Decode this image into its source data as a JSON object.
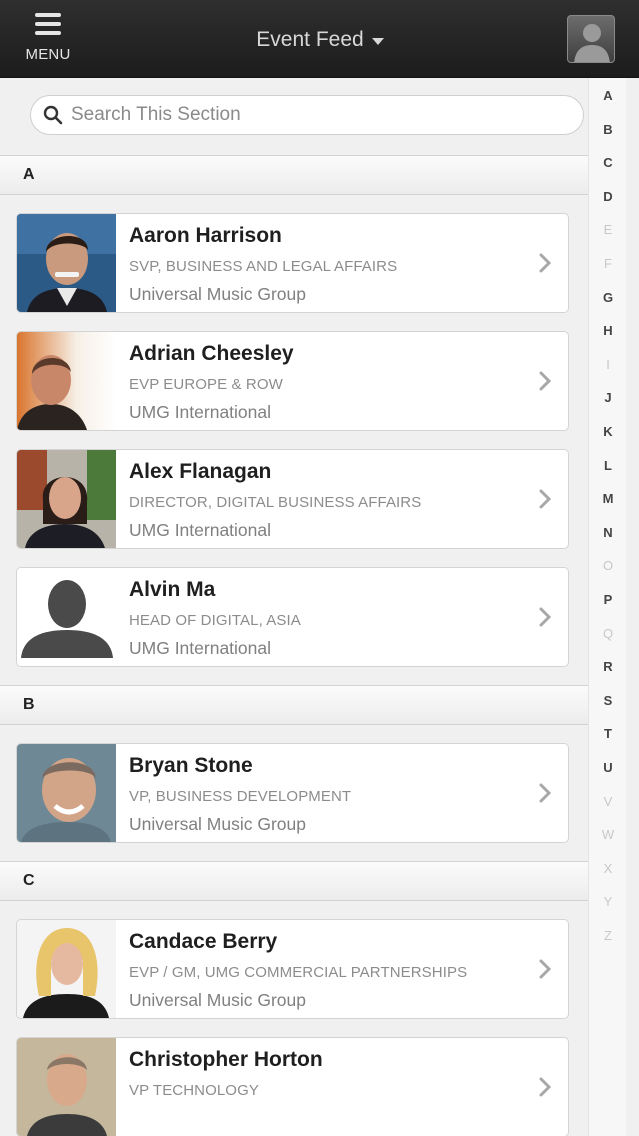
{
  "header": {
    "menu_label": "MENU",
    "title": "Event Feed"
  },
  "search": {
    "placeholder": "Search This Section"
  },
  "sections": [
    {
      "letter": "A",
      "people": [
        {
          "name": "Aaron Harrison",
          "role": "SVP, BUSINESS AND LEGAL AFFAIRS",
          "org": "Universal Music Group",
          "photo": "photo-aaron"
        },
        {
          "name": "Adrian Cheesley",
          "role": "EVP EUROPE & ROW",
          "org": "UMG International",
          "photo": "photo-adrian"
        },
        {
          "name": "Alex Flanagan",
          "role": "DIRECTOR, DIGITAL BUSINESS AFFAIRS",
          "org": "UMG International",
          "photo": "photo-alex"
        },
        {
          "name": "Alvin Ma",
          "role": "HEAD OF DIGITAL, ASIA",
          "org": "UMG International",
          "photo": "placeholder-person-icon"
        }
      ]
    },
    {
      "letter": "B",
      "people": [
        {
          "name": "Bryan Stone",
          "role": "VP, BUSINESS DEVELOPMENT",
          "org": "Universal Music Group",
          "photo": "photo-bryan"
        }
      ]
    },
    {
      "letter": "C",
      "people": [
        {
          "name": "Candace Berry",
          "role": "EVP / GM, UMG COMMERCIAL PARTNERSHIPS",
          "org": "Universal Music Group",
          "photo": "photo-candace"
        },
        {
          "name": "Christopher Horton",
          "role": "VP TECHNOLOGY",
          "org": "",
          "photo": "photo-christopher"
        }
      ]
    }
  ],
  "alphabet_index": [
    {
      "letter": "A",
      "active": true
    },
    {
      "letter": "B",
      "active": true
    },
    {
      "letter": "C",
      "active": true
    },
    {
      "letter": "D",
      "active": true
    },
    {
      "letter": "E",
      "active": false
    },
    {
      "letter": "F",
      "active": false
    },
    {
      "letter": "G",
      "active": true
    },
    {
      "letter": "H",
      "active": true
    },
    {
      "letter": "I",
      "active": false
    },
    {
      "letter": "J",
      "active": true
    },
    {
      "letter": "K",
      "active": true
    },
    {
      "letter": "L",
      "active": true
    },
    {
      "letter": "M",
      "active": true
    },
    {
      "letter": "N",
      "active": true
    },
    {
      "letter": "O",
      "active": false
    },
    {
      "letter": "P",
      "active": true
    },
    {
      "letter": "Q",
      "active": false
    },
    {
      "letter": "R",
      "active": true
    },
    {
      "letter": "S",
      "active": true
    },
    {
      "letter": "T",
      "active": true
    },
    {
      "letter": "U",
      "active": true
    },
    {
      "letter": "V",
      "active": false
    },
    {
      "letter": "W",
      "active": false
    },
    {
      "letter": "X",
      "active": false
    },
    {
      "letter": "Y",
      "active": false
    },
    {
      "letter": "Z",
      "active": false
    }
  ],
  "colors": {
    "header_bg": "#262626",
    "page_bg": "#f0f0f0",
    "card_bg": "#ffffff"
  }
}
